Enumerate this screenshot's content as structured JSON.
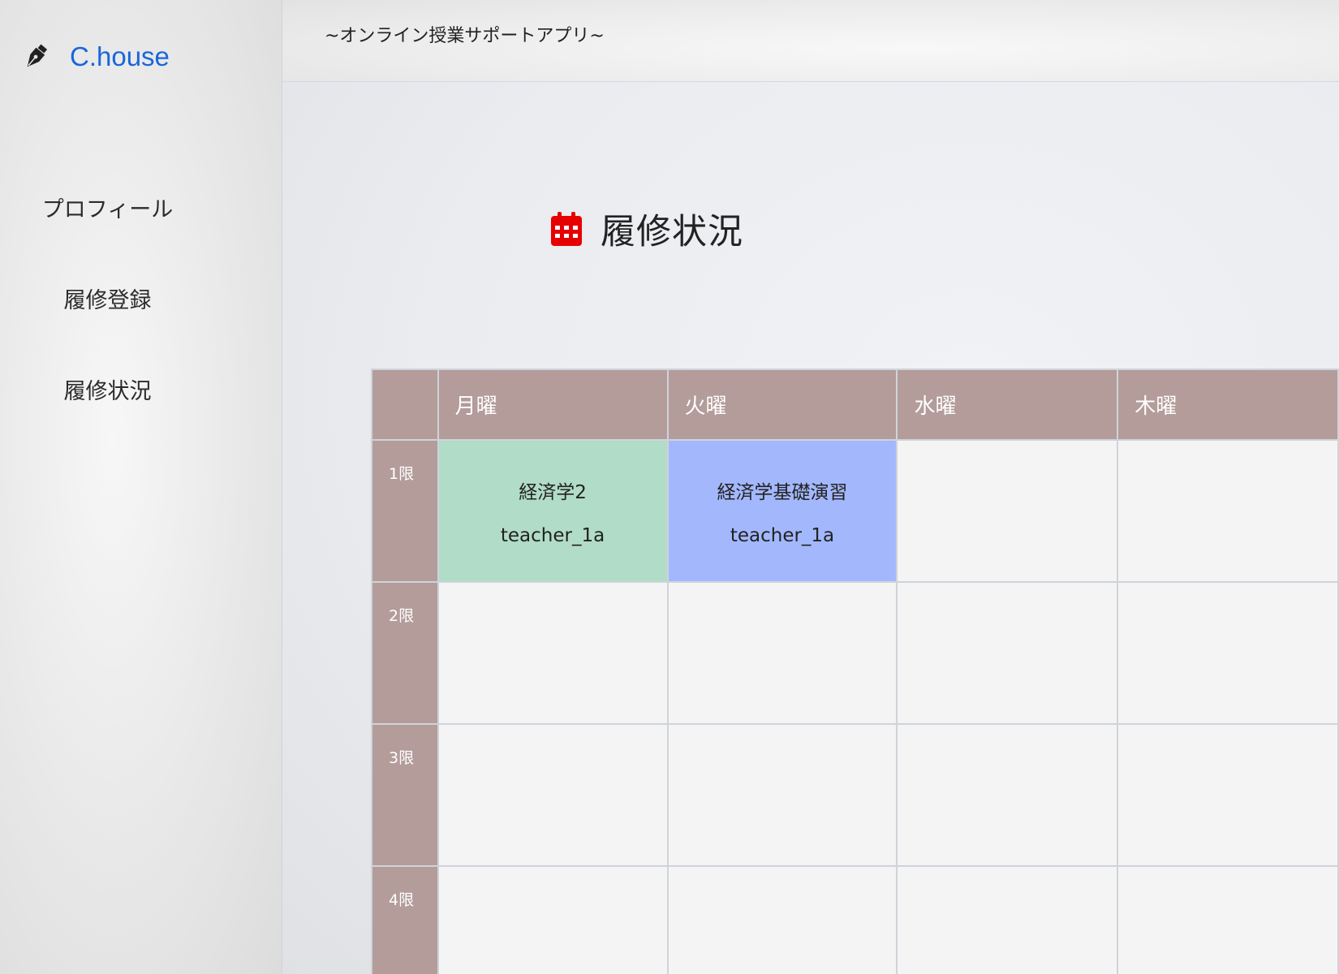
{
  "brand": {
    "name": "C.house"
  },
  "header": {
    "subtitle": "~オンライン授業サポートアプリ~"
  },
  "sidebar": {
    "items": [
      {
        "label": "プロフィール"
      },
      {
        "label": "履修登録"
      },
      {
        "label": "履修状況"
      }
    ]
  },
  "page": {
    "title": "履修状況"
  },
  "colors": {
    "brand": "#1a66d9",
    "header_cells": "#b39c9a",
    "course_green": "#b1dcc8",
    "course_blue": "#a3b8fc",
    "calendar_icon": "#e60000"
  },
  "timetable": {
    "days": [
      "月曜",
      "火曜",
      "水曜",
      "木曜"
    ],
    "periods": [
      "1限",
      "2限",
      "3限",
      "4限"
    ],
    "courses": [
      {
        "name": "経済学2",
        "teacher": "teacher_1a"
      },
      {
        "name": "経済学基礎演習",
        "teacher": "teacher_1a"
      }
    ]
  }
}
